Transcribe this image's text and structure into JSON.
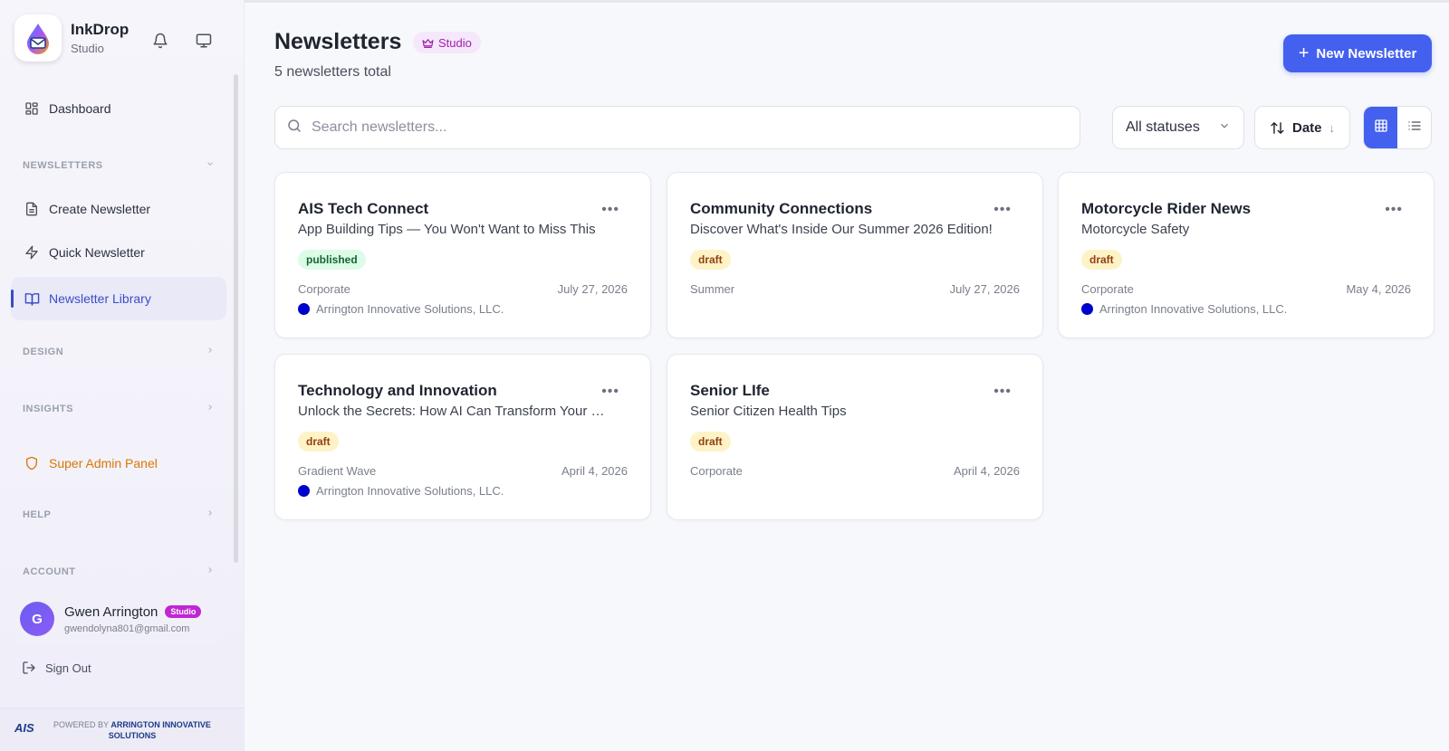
{
  "brand": {
    "name": "InkDrop",
    "sub": "Studio"
  },
  "sidebar": {
    "dashboard": "Dashboard",
    "newsletters_section": "NEWSLETTERS",
    "create": "Create Newsletter",
    "quick": "Quick Newsletter",
    "library": "Newsletter Library",
    "design_section": "DESIGN",
    "insights_section": "INSIGHTS",
    "admin": "Super Admin Panel",
    "help_section": "HELP",
    "account_section": "ACCOUNT"
  },
  "user": {
    "initial": "G",
    "name": "Gwen Arrington",
    "badge": "Studio",
    "email": "gwendolyna801@gmail.com"
  },
  "signout": "Sign Out",
  "footer": {
    "logo": "AIS",
    "powered": "POWERED BY",
    "company": "ARRINGTON INNOVATIVE SOLUTIONS"
  },
  "header": {
    "title": "Newsletters",
    "badge": "Studio",
    "subtitle": "5 newsletters total",
    "new_button": "New Newsletter"
  },
  "toolbar": {
    "search_placeholder": "Search newsletters...",
    "status_filter": "All statuses",
    "sort_label": "Date",
    "sort_arrow": "↓"
  },
  "cards": [
    {
      "title": "AIS Tech Connect",
      "subtitle": "App Building Tips — You Won't Want to Miss This",
      "status": "published",
      "category": "Corporate",
      "date": "July 27, 2026",
      "org": "Arrington Innovative Solutions, LLC."
    },
    {
      "title": "Community Connections",
      "subtitle": "Discover What's Inside Our Summer 2026 Edition!",
      "status": "draft",
      "category": "Summer",
      "date": "July 27, 2026",
      "org": ""
    },
    {
      "title": "Motorcycle Rider News",
      "subtitle": "Motorcycle Safety",
      "status": "draft",
      "category": "Corporate",
      "date": "May 4, 2026",
      "org": "Arrington Innovative Solutions, LLC."
    },
    {
      "title": "Technology and Innovation",
      "subtitle": "Unlock the Secrets: How AI Can Transform Your B...",
      "status": "draft",
      "category": "Gradient Wave",
      "date": "April 4, 2026",
      "org": "Arrington Innovative Solutions, LLC."
    },
    {
      "title": "Senior LIfe",
      "subtitle": "Senior Citizen Health Tips",
      "status": "draft",
      "category": "Corporate",
      "date": "April 4, 2026",
      "org": ""
    }
  ],
  "colors": {
    "accent": "#4361ee",
    "admin": "#d97706",
    "studio": "#a21caf",
    "org_dot": "#0000cc"
  }
}
